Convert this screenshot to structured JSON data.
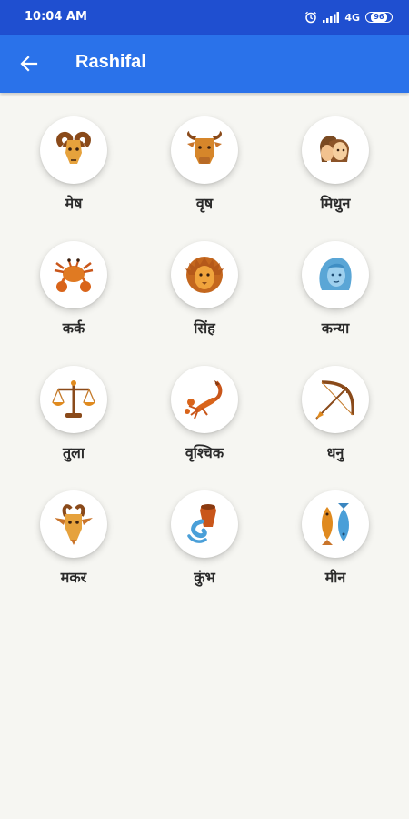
{
  "status": {
    "time": "10:04 AM",
    "network": "4G",
    "battery": "96"
  },
  "appbar": {
    "title": "Rashifal"
  },
  "signs": [
    {
      "label": "मेष",
      "icon": "ram-icon"
    },
    {
      "label": "वृष",
      "icon": "bull-icon"
    },
    {
      "label": "मिथुन",
      "icon": "twins-icon"
    },
    {
      "label": "कर्क",
      "icon": "crab-icon"
    },
    {
      "label": "सिंह",
      "icon": "lion-icon"
    },
    {
      "label": "कन्या",
      "icon": "maiden-icon"
    },
    {
      "label": "तुला",
      "icon": "scales-icon"
    },
    {
      "label": "वृश्चिक",
      "icon": "scorpion-icon"
    },
    {
      "label": "धनु",
      "icon": "bow-arrow-icon"
    },
    {
      "label": "मकर",
      "icon": "goat-icon"
    },
    {
      "label": "कुंभ",
      "icon": "water-bearer-icon"
    },
    {
      "label": "मीन",
      "icon": "fish-icon"
    }
  ],
  "colors": {
    "statusbar": "#1f4fd0",
    "appbar": "#2a72ea",
    "background": "#f6f6f2",
    "icon_orange": "#e08a1e",
    "icon_brown": "#8a4a1a",
    "icon_blue": "#4a9fd8"
  }
}
